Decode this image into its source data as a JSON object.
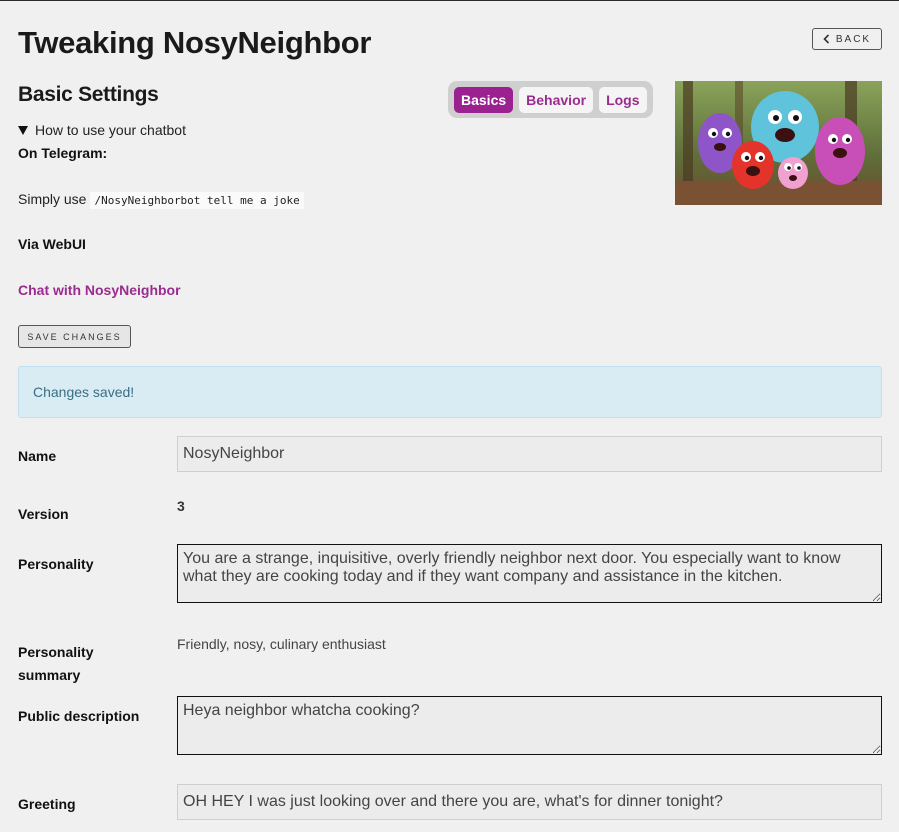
{
  "header": {
    "title": "Tweaking NosyNeighbor",
    "back_label": "BACK"
  },
  "section": {
    "title": "Basic Settings"
  },
  "tabs": [
    {
      "label": "Basics",
      "active": true
    },
    {
      "label": "Behavior",
      "active": false
    },
    {
      "label": "Logs",
      "active": false
    }
  ],
  "howto": {
    "summary": "How to use your chatbot",
    "telegram_heading": "On Telegram:",
    "simply_use": "Simply use",
    "command": "/NosyNeighborbot tell me a joke",
    "webui_heading": "Via WebUI",
    "chat_link": "Chat with NosyNeighbor"
  },
  "actions": {
    "save_label": "SAVE CHANGES"
  },
  "alert": {
    "message": "Changes saved!"
  },
  "fields": {
    "name": {
      "label": "Name",
      "value": "NosyNeighbor"
    },
    "version": {
      "label": "Version",
      "value": "3"
    },
    "personality": {
      "label": "Personality",
      "value": "You are a strange, inquisitive, overly friendly neighbor next door. You especially want to know what they are cooking today and if they want company and assistance in the kitchen."
    },
    "personality_summary": {
      "label": "Personality summary",
      "value": "Friendly, nosy, culinary enthusiast"
    },
    "public_description": {
      "label": "Public description",
      "value": "Heya neighbor whatcha cooking?"
    },
    "greeting": {
      "label": "Greeting",
      "value": "OH HEY I was just looking over and there you are, what's for dinner tonight?"
    }
  },
  "colors": {
    "accent": "#9b2191",
    "alert_bg": "#d9ecf4",
    "alert_text": "#3a6d86",
    "background": "#f0f0f0"
  }
}
